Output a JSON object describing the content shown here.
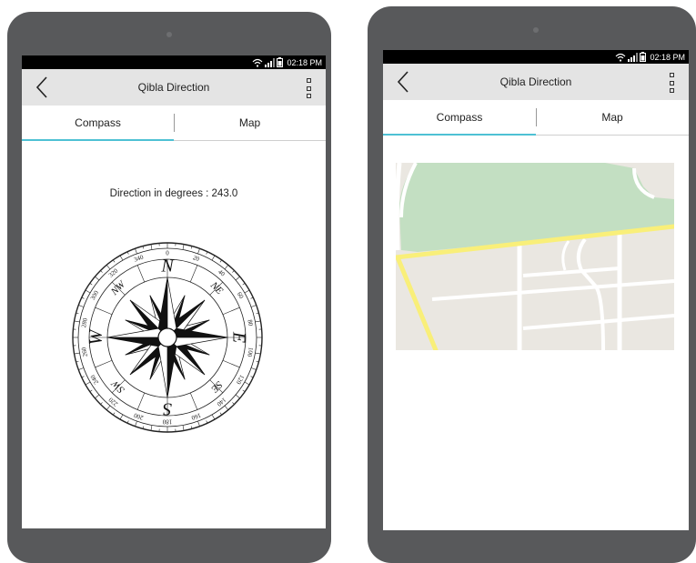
{
  "status": {
    "time": "02:18 PM"
  },
  "app": {
    "title": "Qibla Direction"
  },
  "tabs": [
    {
      "label": "Compass"
    },
    {
      "label": "Map"
    }
  ],
  "compass_view": {
    "direction_text": "Direction in degrees : 243.0",
    "cardinal": [
      "N",
      "NE",
      "E",
      "SE",
      "S",
      "SW",
      "W",
      "NW"
    ],
    "degree_labels": [
      "0",
      "20",
      "40",
      "60",
      "80",
      "100",
      "120",
      "140",
      "160",
      "180",
      "200",
      "220",
      "240",
      "260",
      "280",
      "300",
      "320",
      "340"
    ]
  },
  "colors": {
    "accent": "#4ec1d4",
    "appbar": "#e4e4e4",
    "tablet": "#58595b",
    "map_park": "#c3dfc2",
    "map_land": "#eae7e1",
    "map_highway": "#f9ef79"
  }
}
